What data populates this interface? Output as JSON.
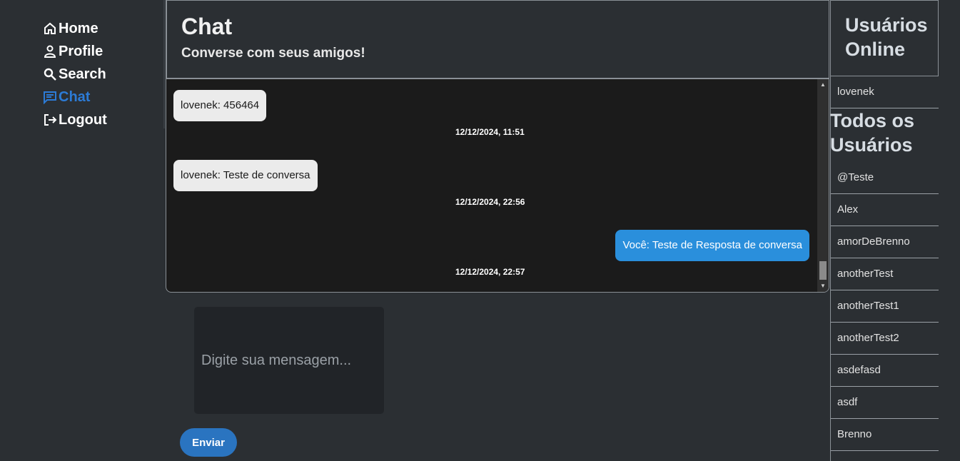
{
  "nav": {
    "items": [
      {
        "label": "Home",
        "icon": "home-icon"
      },
      {
        "label": "Profile",
        "icon": "person-icon"
      },
      {
        "label": "Search",
        "icon": "search-icon"
      },
      {
        "label": "Chat",
        "icon": "chat-icon",
        "active": true
      },
      {
        "label": "Logout",
        "icon": "logout-icon"
      }
    ]
  },
  "header": {
    "title": "Chat",
    "subtitle": "Converse com seus amigos!"
  },
  "messages": [
    {
      "text": "lovenek: 456464",
      "time": "12/12/2024, 11:51",
      "direction": "in"
    },
    {
      "text": "lovenek: Teste de conversa",
      "time": "12/12/2024, 22:56",
      "direction": "in"
    },
    {
      "text": "Você: Teste de Resposta de conversa",
      "time": "12/12/2024, 22:57",
      "direction": "out"
    }
  ],
  "composer": {
    "placeholder": "Digite sua mensagem...",
    "send_label": "Enviar"
  },
  "online": {
    "title": "Usuários Online",
    "users": [
      "lovenek"
    ]
  },
  "all_users": {
    "title": "Todos os Usuários",
    "users": [
      "@Teste",
      "Alex",
      "amorDeBrenno",
      "anotherTest",
      "anotherTest1",
      "anotherTest2",
      "asdefasd",
      "asdf",
      "Brenno"
    ]
  },
  "colors": {
    "background": "#2b2f33",
    "accent": "#2c7bd6",
    "outgoing_bubble": "#2a8fdc",
    "incoming_bubble": "#ebebeb",
    "chat_background": "#1b1b1b"
  }
}
